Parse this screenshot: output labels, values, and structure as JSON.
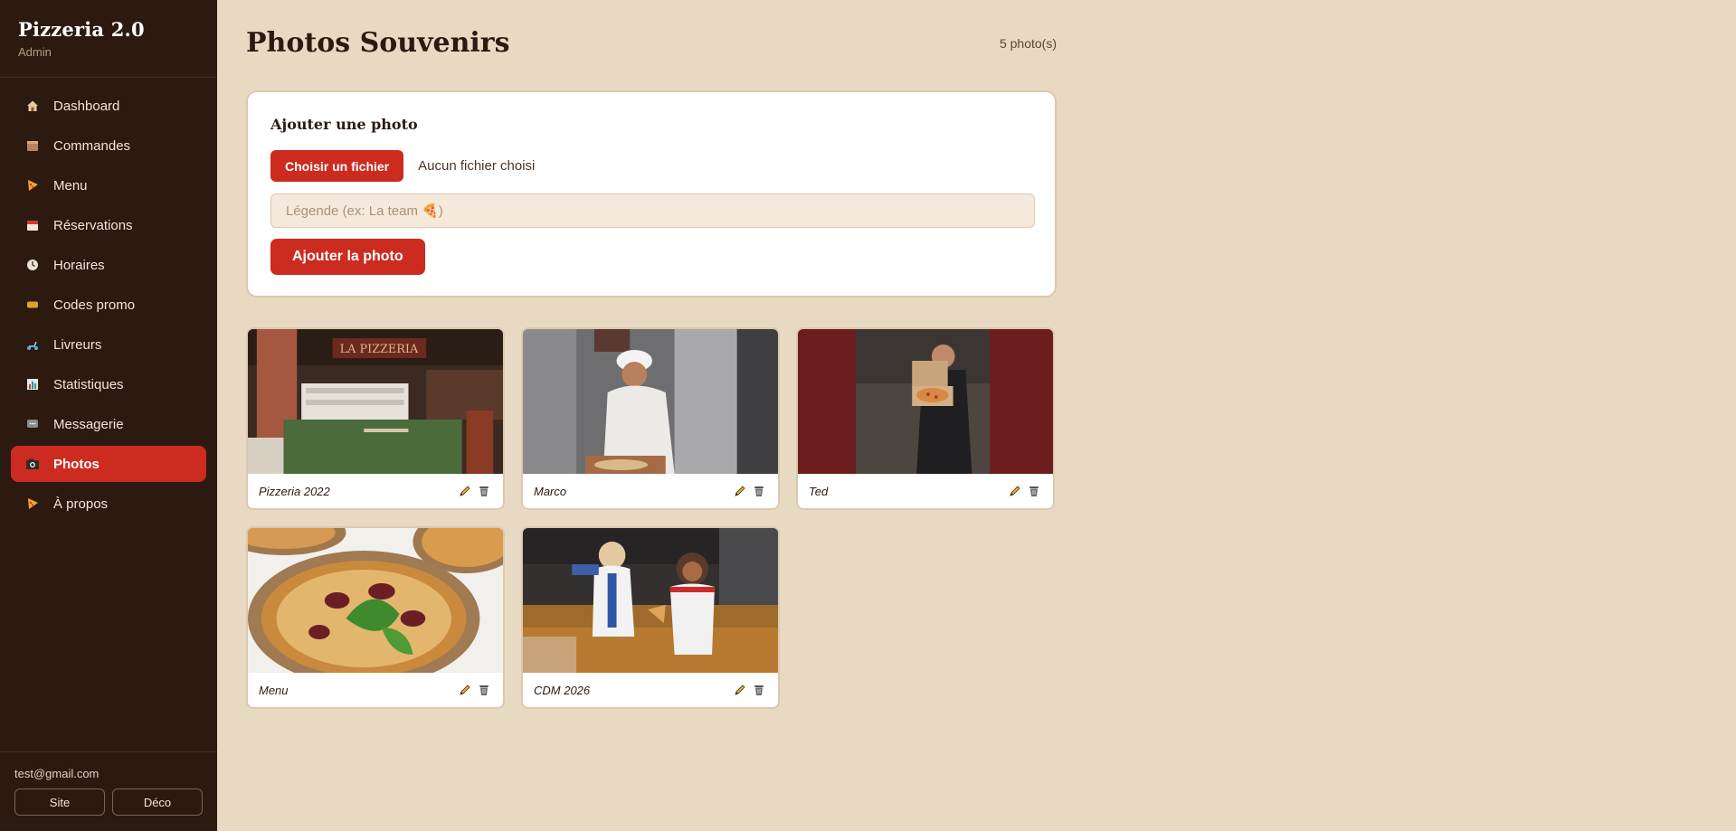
{
  "sidebar": {
    "brand_title": "Pizzeria 2.0",
    "brand_sub": "Admin",
    "items": [
      {
        "label": "Dashboard",
        "icon": "home-icon"
      },
      {
        "label": "Commandes",
        "icon": "box-icon"
      },
      {
        "label": "Menu",
        "icon": "pizza-icon"
      },
      {
        "label": "Réservations",
        "icon": "calendar-icon"
      },
      {
        "label": "Horaires",
        "icon": "clock-icon"
      },
      {
        "label": "Codes promo",
        "icon": "ticket-icon"
      },
      {
        "label": "Livreurs",
        "icon": "scooter-icon"
      },
      {
        "label": "Statistiques",
        "icon": "chart-icon"
      },
      {
        "label": "Messagerie",
        "icon": "chat-icon"
      },
      {
        "label": "Photos",
        "icon": "camera-icon",
        "active": true
      },
      {
        "label": "À propos",
        "icon": "pizza-icon"
      }
    ],
    "footer": {
      "email": "test@gmail.com",
      "site_label": "Site",
      "logout_label": "Déco"
    }
  },
  "header": {
    "title": "Photos Souvenirs",
    "count": "5 photo(s)"
  },
  "upload": {
    "title": "Ajouter une photo",
    "choose_file_label": "Choisir un fichier",
    "file_status": "Aucun fichier choisi",
    "caption_placeholder": "Légende (ex: La team 🍕)",
    "caption_value": "",
    "submit_label": "Ajouter la photo"
  },
  "photos": [
    {
      "caption": "Pizzeria 2022",
      "scene": "pizzeria-interior"
    },
    {
      "caption": "Marco",
      "scene": "pizza-chef"
    },
    {
      "caption": "Ted",
      "scene": "man-with-pizza-box"
    },
    {
      "caption": "Menu",
      "scene": "pizzas-on-boards"
    },
    {
      "caption": "CDM 2026",
      "scene": "friends-on-sofa"
    }
  ],
  "colors": {
    "accent": "#cc2b1f",
    "sidebar_bg": "#2c1a10",
    "page_bg": "#e8d9c3",
    "card_border": "#dcc8ad"
  }
}
